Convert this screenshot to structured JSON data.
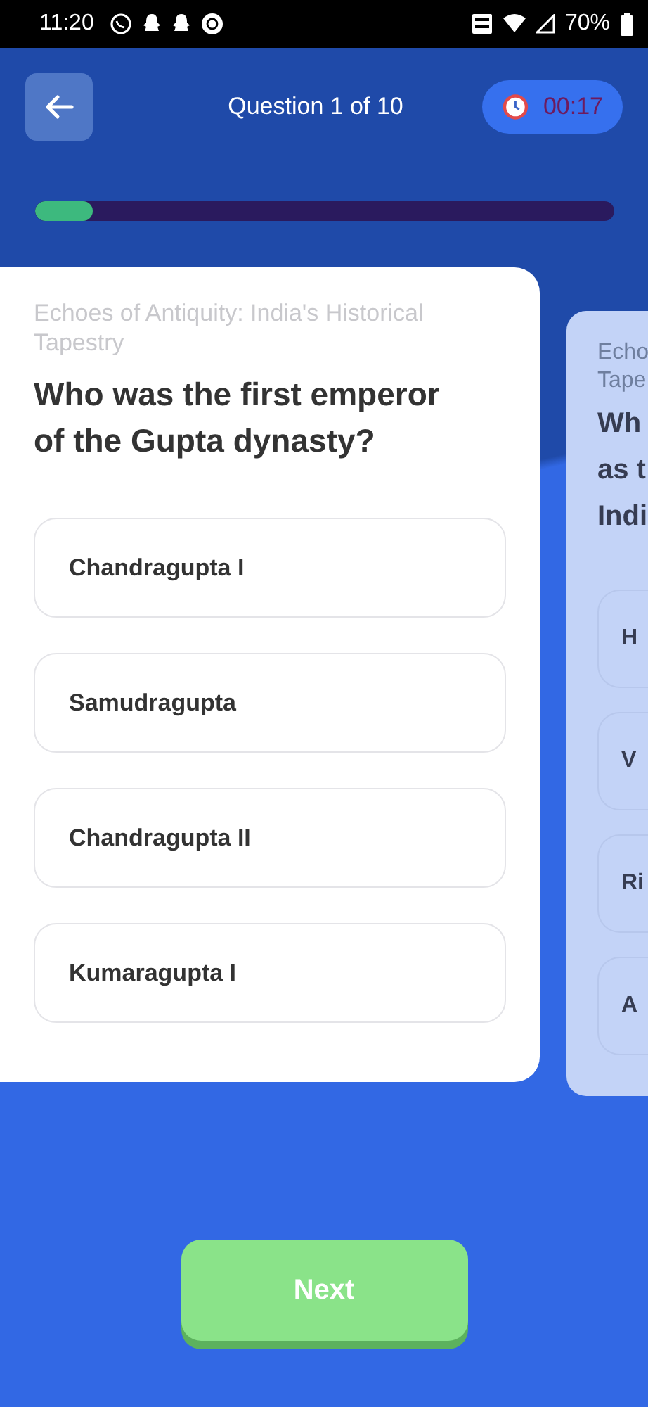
{
  "status_bar": {
    "time": "11:20",
    "battery": "70%"
  },
  "header": {
    "title": "Question 1 of 10",
    "timer": "00:17"
  },
  "progress": {
    "level": 0.1
  },
  "card": {
    "category": "Echoes of Antiquity: India's Historical Tapestry",
    "question": "Who was the first emperor of the Gupta dynasty?",
    "options": [
      {
        "label": "Chandragupta I",
        "selected": false
      },
      {
        "label": "Samudragupta",
        "selected": false
      },
      {
        "label": "Chandragupta II",
        "selected": false
      },
      {
        "label": "Kumaragupta I",
        "selected": false
      }
    ]
  },
  "next_card": {
    "category_lines": [
      "Echo",
      "Tape"
    ],
    "question_lines": [
      "Wh",
      "as t",
      "Indi"
    ],
    "options": [
      {
        "label": "H",
        "selected": false
      },
      {
        "label": "V",
        "selected": false
      },
      {
        "label": "Ri",
        "selected": false
      },
      {
        "label": "A",
        "selected": false
      }
    ]
  },
  "next_button": {
    "label": "Next"
  }
}
